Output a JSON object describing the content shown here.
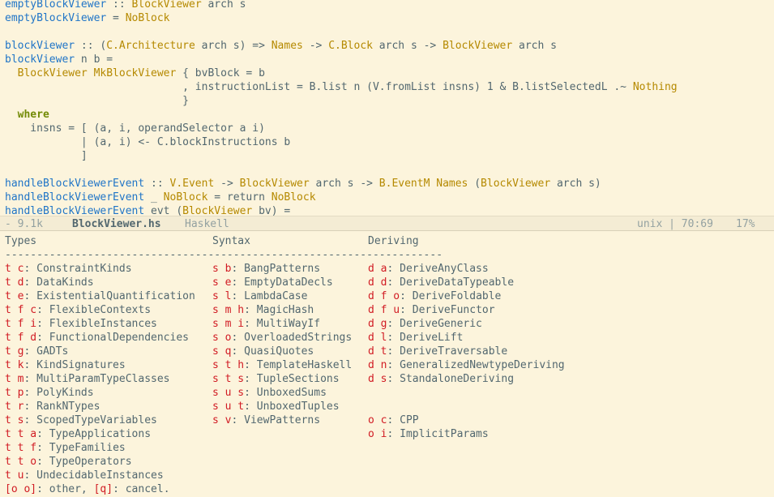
{
  "code": {
    "l1": {
      "a": "emptyBlockViewer",
      "b": " :: ",
      "c": "BlockViewer",
      "d": " arch s"
    },
    "l2": {
      "a": "emptyBlockViewer",
      "b": " = ",
      "c": "NoBlock"
    },
    "l4": {
      "a": "blockViewer",
      "b": " :: (",
      "c": "C.Architecture",
      "d": " arch s) => ",
      "e": "Names",
      "f": " -> ",
      "g": "C.Block",
      "h": " arch s -> ",
      "i": "BlockViewer",
      "j": " arch s"
    },
    "l5": {
      "a": "blockViewer",
      "b": " n b ="
    },
    "l6": {
      "a": "  ",
      "b": "BlockViewer",
      "c": " ",
      "d": "MkBlockViewer",
      "e": " { bvBlock = b"
    },
    "l7": {
      "a": "                            , instructionList = B.list n (V.fromList insns) 1 & B.listSelectedL .~ ",
      "b": "Nothing"
    },
    "l8": {
      "a": "                            }"
    },
    "l10": {
      "a": "  ",
      "b": "where"
    },
    "l11": {
      "a": "    insns = [ (a, i, operandSelector a i)"
    },
    "l12": {
      "a": "            | (a, i) <- C.blockInstructions b"
    },
    "l13": {
      "a": "            ]"
    },
    "l15": {
      "a": "handleBlockViewerEvent",
      "b": " :: ",
      "c": "V.Event",
      "d": " -> ",
      "e": "BlockViewer",
      "f": " arch s -> ",
      "g": "B.EventM",
      "h": " ",
      "i": "Names",
      "j": " (",
      "k": "BlockViewer",
      "l": " arch s)"
    },
    "l16": {
      "a": "handleBlockViewerEvent",
      "b": " _ ",
      "c": "NoBlock",
      "d": " = return ",
      "e": "NoBlock"
    },
    "l17": {
      "a": "handleBlockViewerEvent",
      "b": " evt (",
      "c": "BlockViewer",
      "d": " bv) ="
    }
  },
  "modeline": {
    "size": "- 9.1k",
    "filename": "BlockViewer.hs",
    "mode": "Haskell",
    "encoding": "unix | 70:69",
    "percent": "17%"
  },
  "hydra": {
    "headers": {
      "types": "Types",
      "syntax": "Syntax",
      "deriving": "Deriving"
    },
    "divider": "---------------------------------------------------------------------",
    "types": [
      {
        "key": "t c",
        "label": "ConstraintKinds"
      },
      {
        "key": "t d",
        "label": "DataKinds"
      },
      {
        "key": "t e",
        "label": "ExistentialQuantification"
      },
      {
        "key": "t f c",
        "label": "FlexibleContexts"
      },
      {
        "key": "t f i",
        "label": "FlexibleInstances"
      },
      {
        "key": "t f d",
        "label": "FunctionalDependencies"
      },
      {
        "key": "t g",
        "label": "GADTs"
      },
      {
        "key": "t k",
        "label": "KindSignatures"
      },
      {
        "key": "t m",
        "label": "MultiParamTypeClasses"
      },
      {
        "key": "t p",
        "label": "PolyKinds"
      },
      {
        "key": "t r",
        "label": "RankNTypes"
      },
      {
        "key": "t s",
        "label": "ScopedTypeVariables"
      },
      {
        "key": "t t a",
        "label": "TypeApplications"
      },
      {
        "key": "t t f",
        "label": "TypeFamilies"
      },
      {
        "key": "t t o",
        "label": "TypeOperators"
      },
      {
        "key": "t u",
        "label": "UndecidableInstances"
      }
    ],
    "syntax": [
      {
        "key": "s b",
        "label": "BangPatterns"
      },
      {
        "key": "s e",
        "label": "EmptyDataDecls"
      },
      {
        "key": "s l",
        "label": "LambdaCase"
      },
      {
        "key": "s m h",
        "label": "MagicHash"
      },
      {
        "key": "s m i",
        "label": "MultiWayIf"
      },
      {
        "key": "s o",
        "label": "OverloadedStrings"
      },
      {
        "key": "s q",
        "label": "QuasiQuotes"
      },
      {
        "key": "s t h",
        "label": "TemplateHaskell"
      },
      {
        "key": "s t s",
        "label": "TupleSections"
      },
      {
        "key": "s u s",
        "label": "UnboxedSums"
      },
      {
        "key": "s u t",
        "label": "UnboxedTuples"
      },
      {
        "key": "s v",
        "label": "ViewPatterns"
      }
    ],
    "deriving": [
      {
        "key": "d a",
        "label": "DeriveAnyClass"
      },
      {
        "key": "d d",
        "label": "DeriveDataTypeable"
      },
      {
        "key": "d f o",
        "label": "DeriveFoldable"
      },
      {
        "key": "d f u",
        "label": "DeriveFunctor"
      },
      {
        "key": "d g",
        "label": "DeriveGeneric"
      },
      {
        "key": "d l",
        "label": "DeriveLift"
      },
      {
        "key": "d t",
        "label": "DeriveTraversable"
      },
      {
        "key": "d n",
        "label": "GeneralizedNewtypeDeriving"
      },
      {
        "key": "d s",
        "label": "StandaloneDeriving"
      }
    ],
    "other": [
      {
        "key": "o c",
        "label": "CPP"
      },
      {
        "key": "o i",
        "label": "ImplicitParams"
      }
    ],
    "footer": {
      "k1": "[o o]",
      "t1": ": other, ",
      "k2": "[q]",
      "t2": ": cancel."
    }
  },
  "colors": {
    "background": "#fcf4dc",
    "keyword": "#d11c24",
    "function": "#2075c7",
    "type": "#b58900",
    "where": "#728a05"
  }
}
